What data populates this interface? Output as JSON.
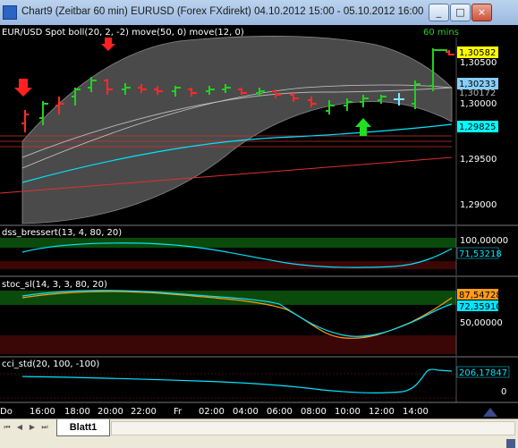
{
  "window": {
    "title": "Chart9 (Zeitbar 60 min)  EURUSD (Forex FXdirekt) 04.10.2012 15:00 - 05.10.2012 16:00",
    "minimize": "_",
    "maximize": "□",
    "close": "×"
  },
  "main_panel": {
    "legend": "EUR/USD Spot boll(20, 2, -2) move(50, 0) move(12, 0)",
    "timeframe": "60 mins",
    "tick_labels": [
      "1,30500",
      "1,30000",
      "1,29500",
      "1,29000"
    ],
    "price_tags": [
      "1,30582",
      "1,30233",
      "1,30172",
      "1,29825"
    ],
    "tag_colors": [
      "#ffff00",
      "#87cefa",
      "#b4b4b4",
      "#00ffff"
    ]
  },
  "dss_panel": {
    "legend": "dss_bressert(13, 4, 80, 20)",
    "tick_labels": [
      "100,00000"
    ],
    "value_tag": "71,53218"
  },
  "stoc_panel": {
    "legend": "stoc_sl(14, 3, 3, 80, 20)",
    "tick_labels": [
      "50,00000"
    ],
    "value_tags": [
      "87,54728",
      "72,35910"
    ]
  },
  "cci_panel": {
    "legend": "cci_std(20, 100, -100)",
    "tick_labels": [
      "0"
    ],
    "value_tag": "206,17847"
  },
  "x_axis": {
    "labels": [
      "Do",
      "16:00",
      "18:00",
      "20:00",
      "22:00",
      "Fr",
      "02:00",
      "04:00",
      "06:00",
      "08:00",
      "10:00",
      "12:00",
      "14:00"
    ]
  },
  "sheet": {
    "tab_label": "Blatt1",
    "nav_first": "⏮",
    "nav_prev": "◀",
    "nav_next": "▶",
    "nav_last": "⏭"
  },
  "chart_data": [
    {
      "type": "line",
      "name": "EURUSD main panel",
      "candle_closes": [
        1.2975,
        1.301,
        1.3015,
        1.302,
        1.3025,
        1.3035,
        1.303,
        1.303,
        1.303,
        1.303,
        1.3028,
        1.3025,
        1.303,
        1.3028,
        1.303,
        1.3025,
        1.3022,
        1.302,
        1.302,
        1.3015,
        1.301,
        1.3015,
        1.3018,
        1.302,
        1.3022,
        1.3025,
        1.3055,
        1.3057
      ],
      "ylim": [
        1.288,
        1.308
      ]
    },
    {
      "type": "line",
      "name": "dss_bressert",
      "values": [
        78,
        82,
        86,
        88,
        90,
        89,
        87,
        86,
        85,
        84,
        82,
        80,
        78,
        76,
        74,
        72,
        70,
        69,
        68,
        68,
        70,
        72,
        74,
        78,
        82,
        88,
        92
      ],
      "ylim": [
        50,
        100
      ]
    },
    {
      "type": "line",
      "name": "stoc_sl",
      "values": [
        80,
        84,
        86,
        88,
        88,
        86,
        84,
        82,
        80,
        78,
        76,
        74,
        70,
        60,
        45,
        30,
        22,
        20,
        22,
        28,
        36,
        44,
        50,
        58,
        66,
        76,
        87
      ],
      "ylim": [
        0,
        100
      ]
    },
    {
      "type": "line",
      "name": "cci_std",
      "values": [
        60,
        55,
        50,
        48,
        45,
        42,
        40,
        36,
        32,
        28,
        22,
        18,
        12,
        6,
        0,
        -5,
        -10,
        -14,
        -16,
        -16,
        -14,
        -10,
        -5,
        10,
        60,
        206,
        200
      ],
      "ylim": [
        -50,
        250
      ]
    }
  ]
}
